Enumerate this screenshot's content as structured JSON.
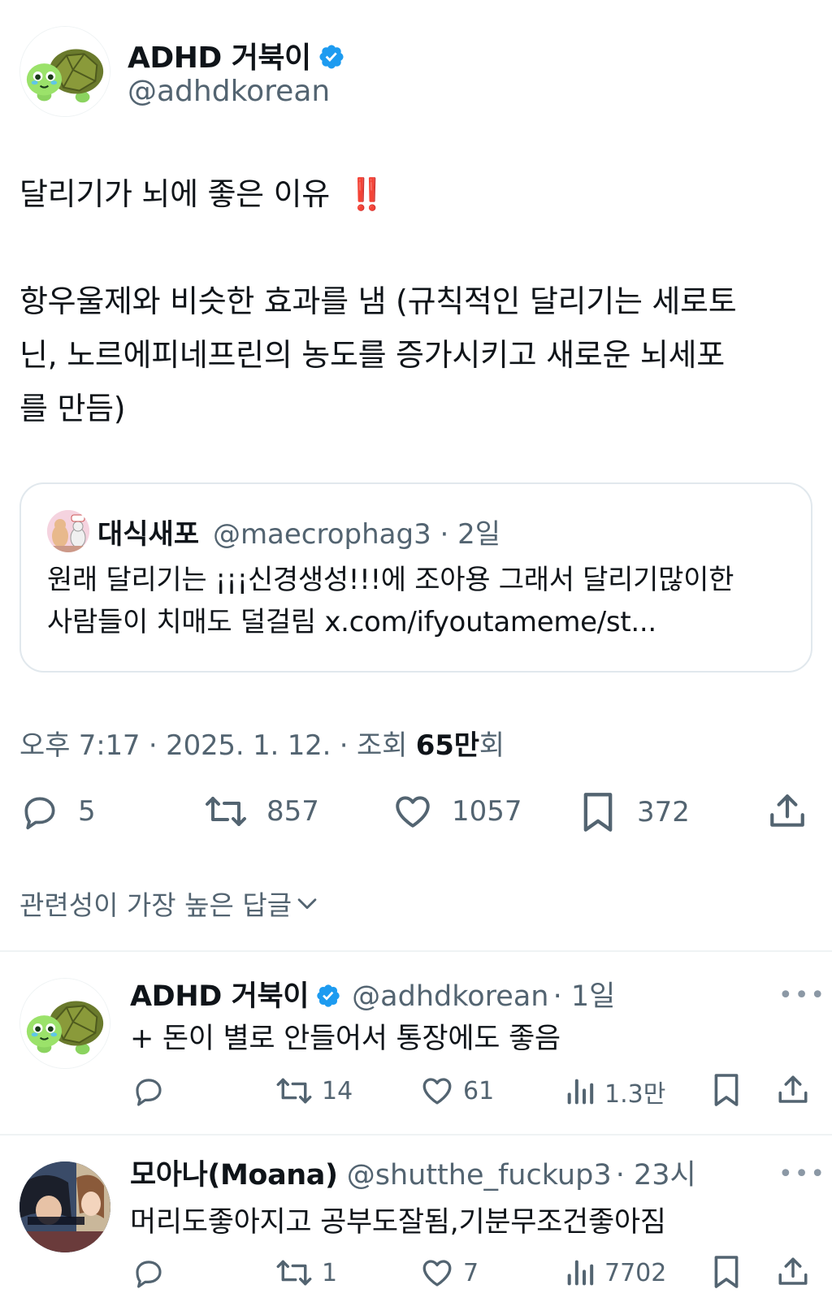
{
  "author": {
    "name": "ADHD 거북이",
    "handle": "@adhdkorean",
    "avatar_icon": "turtle-avatar-icon",
    "verified": true
  },
  "tweet": {
    "title_line": "달리기가 뇌에 좋은 이유",
    "emoji": "‼️",
    "body_lines": [
      "항우울제와 비슷한 효과를 냄 (규칙적인 달리기는 세로토",
      "닌, 노르에피네프린의 농도를 증가시키고 새로운 뇌세포",
      "를 만듬)"
    ]
  },
  "quote": {
    "name": "대식새포",
    "handle": "@maecrophag3",
    "time": "· 2일",
    "lines": [
      "원래 달리기는 ¡¡¡신경생성!!!에 조아용 그래서 달리기많이한",
      "사람들이 치매도 덜걸림 x.com/ifyoutameme/st..."
    ]
  },
  "meta": {
    "time": "오후 7:17 · 2025. 1. 12. · 조회 ",
    "views_number": "65만",
    "views_suffix": "회"
  },
  "actions": {
    "replies": "5",
    "retweets": "857",
    "likes": "1057",
    "bookmarks": "372"
  },
  "sort_label": "관련성이 가장 높은 답글",
  "replies": [
    {
      "name": "ADHD 거북이",
      "handle": "@adhdkorean",
      "time": "· 1일",
      "text": "+ 돈이 별로 안들어서 통장에도 좋음",
      "retweets": "14",
      "likes": "61",
      "views": "1.3만",
      "verified": true
    },
    {
      "name": "모아나(Moana)",
      "handle": "@shutthe_fuckup3",
      "time": "· 23시",
      "text": "머리도좋아지고 공부도잘됨,기분무조건좋아짐",
      "retweets": "1",
      "likes": "7",
      "views": "7702",
      "verified": false
    }
  ],
  "colors": {
    "text": "#0f1419",
    "secondary": "#536471",
    "verified": "#1d9bf0",
    "emoji_red": "#e0245e",
    "border": "#e1e8ed"
  }
}
